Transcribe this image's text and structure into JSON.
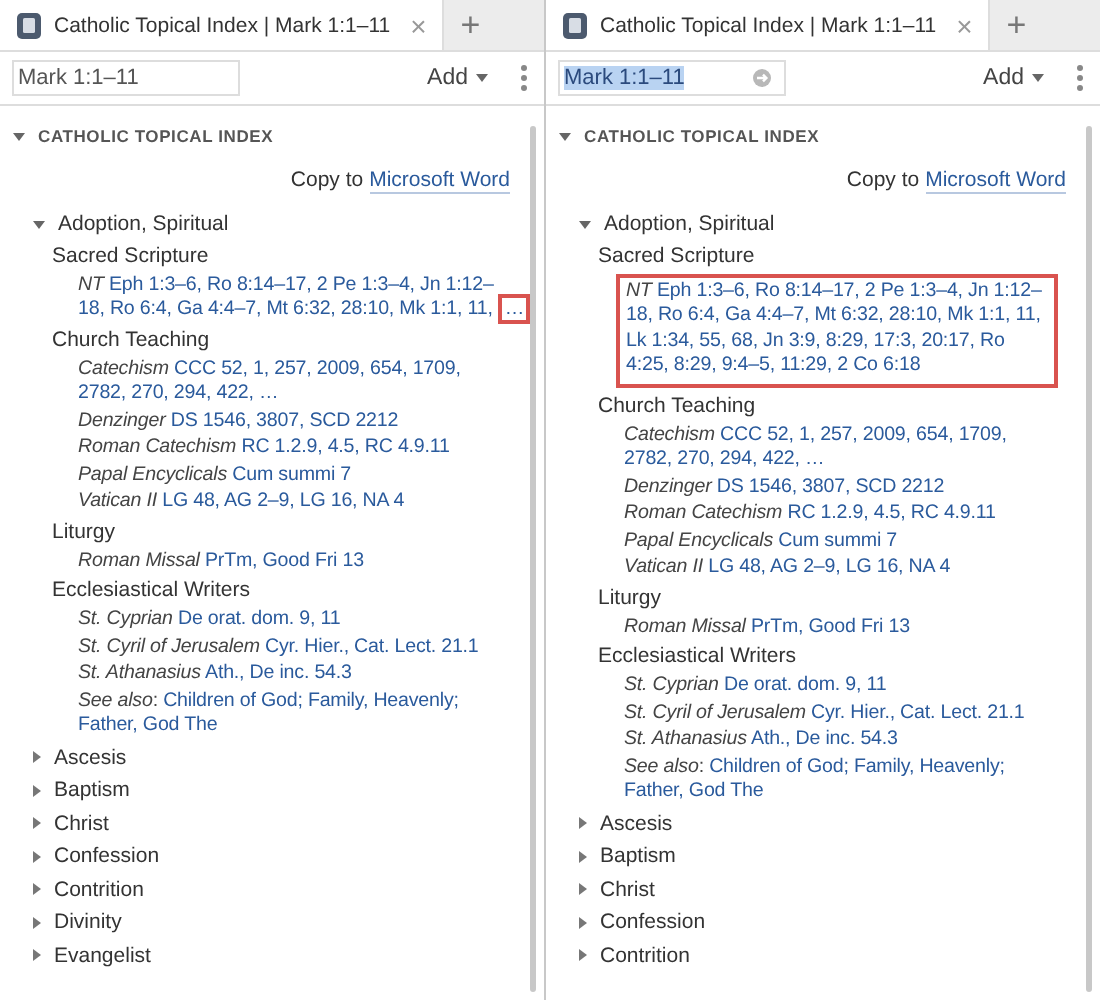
{
  "panels": [
    {
      "tab": {
        "title": "Catholic Topical Index | Mark 1:1–11",
        "close": "×",
        "selected": true
      },
      "new_tab": "+",
      "reference": {
        "value": "Mark 1:1–11",
        "text_selected": false
      },
      "add_button": "Add",
      "section": {
        "title": "CATHOLIC TOPICAL INDEX",
        "expanded": true
      },
      "copy": {
        "text": "Copy to",
        "link": "Microsoft Word"
      },
      "topics": [
        {
          "label": "Adoption, Spiritual",
          "expanded": true,
          "groups": [
            {
              "heading": "Sacred Scripture",
              "entries": [
                {
                  "source": "NT",
                  "refs": "Eph 1:3–6, Ro 8:14–17, 2 Pe 1:3–4, Jn 1:12–18, Ro 6:4, Ga 4:4–7, Mt 6:32, 28:10, Mk 1:1, 11,",
                  "more": {
                    "label": "…",
                    "highlighted": true
                  },
                  "highlighted": false
                }
              ]
            },
            {
              "heading": "Church Teaching",
              "entries": [
                {
                  "source": "Catechism",
                  "refs": "CCC 52, 1, 257, 2009, 654, 1709, 2782, 270, 294, 422, …",
                  "highlighted": false
                },
                {
                  "source": "Denzinger",
                  "refs": "DS 1546, 3807, SCD 2212",
                  "highlighted": false
                },
                {
                  "source": "Roman Catechism",
                  "refs": "RC 1.2.9, 4.5, RC 4.9.11",
                  "highlighted": false
                },
                {
                  "source": "Papal Encyclicals",
                  "refs": "Cum summi 7",
                  "highlighted": false
                },
                {
                  "source": "Vatican II",
                  "refs": "LG 48, AG 2–9, LG 16, NA 4",
                  "highlighted": false
                }
              ]
            },
            {
              "heading": "Liturgy",
              "entries": [
                {
                  "source": "Roman Missal",
                  "refs": "PrTm, Good Fri 13",
                  "highlighted": false
                }
              ]
            },
            {
              "heading": "Ecclesiastical Writers",
              "entries": [
                {
                  "source": "St. Cyprian",
                  "refs": "De orat. dom. 9, 11",
                  "highlighted": false
                },
                {
                  "source": "St. Cyril of Jerusalem",
                  "refs": "Cyr. Hier., Cat. Lect. 21.1",
                  "highlighted": false
                },
                {
                  "source": "St. Athanasius",
                  "refs": "Ath., De inc. 54.3",
                  "highlighted": false
                }
              ]
            }
          ],
          "see_also": {
            "label": "*See also*:",
            "refs": "Children of God; Family, Heavenly; Father, God The"
          }
        },
        {
          "label": "Ascesis",
          "expanded": false
        },
        {
          "label": "Baptism",
          "expanded": false
        },
        {
          "label": "Christ",
          "expanded": false
        },
        {
          "label": "Confession",
          "expanded": false
        },
        {
          "label": "Contrition",
          "expanded": false
        },
        {
          "label": "Divinity",
          "expanded": false
        },
        {
          "label": "Evangelist",
          "expanded": false
        }
      ]
    },
    {
      "tab": {
        "title": "Catholic Topical Index | Mark 1:1–11",
        "close": "×",
        "selected": true
      },
      "new_tab": "+",
      "reference": {
        "value": "Mark 1:1–11",
        "text_selected": true
      },
      "add_button": "Add",
      "section": {
        "title": "CATHOLIC TOPICAL INDEX",
        "expanded": true
      },
      "copy": {
        "text": "Copy to",
        "link": "Microsoft Word"
      },
      "topics": [
        {
          "label": "Adoption, Spiritual",
          "expanded": true,
          "groups": [
            {
              "heading": "Sacred Scripture",
              "entries": [
                {
                  "source": "NT",
                  "refs": "Eph 1:3–6, Ro 8:14–17, 2 Pe 1:3–4, Jn 1:12–18, Ro 6:4, Ga 4:4–7, Mt 6:32, 28:10, Mk 1:1, 11, Lk 1:34, 55, 68, Jn 3:9, 8:29, 17:3, 20:17, Ro 4:25, 8:29, 9:4–5, 11:29, 2 Co 6:18",
                  "highlighted": true
                }
              ]
            },
            {
              "heading": "Church Teaching",
              "entries": [
                {
                  "source": "Catechism",
                  "refs": "CCC 52, 1, 257, 2009, 654, 1709, 2782, 270, 294, 422, …",
                  "highlighted": false
                },
                {
                  "source": "Denzinger",
                  "refs": "DS 1546, 3807, SCD 2212",
                  "highlighted": false
                },
                {
                  "source": "Roman Catechism",
                  "refs": "RC 1.2.9, 4.5, RC 4.9.11",
                  "highlighted": false
                },
                {
                  "source": "Papal Encyclicals",
                  "refs": "Cum summi 7",
                  "highlighted": false
                },
                {
                  "source": "Vatican II",
                  "refs": "LG 48, AG 2–9, LG 16, NA 4",
                  "highlighted": false
                }
              ]
            },
            {
              "heading": "Liturgy",
              "entries": [
                {
                  "source": "Roman Missal",
                  "refs": "PrTm, Good Fri 13",
                  "highlighted": false
                }
              ]
            },
            {
              "heading": "Ecclesiastical Writers",
              "entries": [
                {
                  "source": "St. Cyprian",
                  "refs": "De orat. dom. 9, 11",
                  "highlighted": false
                },
                {
                  "source": "St. Cyril of Jerusalem",
                  "refs": "Cyr. Hier., Cat. Lect. 21.1",
                  "highlighted": false
                },
                {
                  "source": "St. Athanasius",
                  "refs": "Ath., De inc. 54.3",
                  "highlighted": false
                }
              ]
            }
          ],
          "see_also": {
            "label": "*See also*:",
            "refs": "Children of God; Family, Heavenly; Father, God The"
          }
        },
        {
          "label": "Ascesis",
          "expanded": false
        },
        {
          "label": "Baptism",
          "expanded": false
        },
        {
          "label": "Christ",
          "expanded": false
        },
        {
          "label": "Confession",
          "expanded": false
        },
        {
          "label": "Contrition",
          "expanded": false
        }
      ]
    }
  ]
}
